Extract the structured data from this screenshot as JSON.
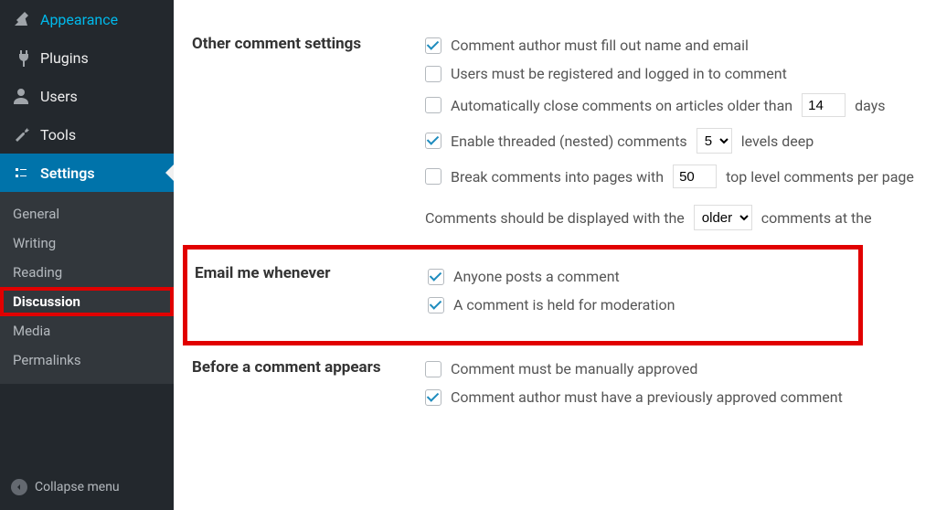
{
  "sidebar": {
    "items": [
      {
        "label": "Appearance",
        "icon": "appearance-icon"
      },
      {
        "label": "Plugins",
        "icon": "plugins-icon"
      },
      {
        "label": "Users",
        "icon": "users-icon"
      },
      {
        "label": "Tools",
        "icon": "tools-icon"
      },
      {
        "label": "Settings",
        "icon": "settings-icon"
      }
    ],
    "submenu": [
      "General",
      "Writing",
      "Reading",
      "Discussion",
      "Media",
      "Permalinks"
    ],
    "collapse_label": "Collapse menu"
  },
  "sections": {
    "other_comment": {
      "title": "Other comment settings",
      "opts": {
        "fill_name": "Comment author must fill out name and email",
        "registered": "Users must be registered and logged in to comment",
        "autoclose_pre": "Automatically close comments on articles older than",
        "autoclose_days": "14",
        "autoclose_suffix": "days",
        "threaded_pre": "Enable threaded (nested) comments",
        "threaded_levels": "5",
        "threaded_suffix": "levels deep",
        "break_pre": "Break comments into pages with",
        "break_count": "50",
        "break_suffix": "top level comments per page",
        "display_pre": "Comments should be displayed with the",
        "display_order": "older",
        "display_suffix": "comments at the"
      }
    },
    "email_me": {
      "title": "Email me whenever",
      "opts": {
        "anyone_posts": "Anyone posts a comment",
        "held_moderation": "A comment is held for moderation"
      }
    },
    "before_appear": {
      "title": "Before a comment appears",
      "opts": {
        "manual_approve": "Comment must be manually approved",
        "prev_approved": "Comment author must have a previously approved comment"
      }
    }
  }
}
